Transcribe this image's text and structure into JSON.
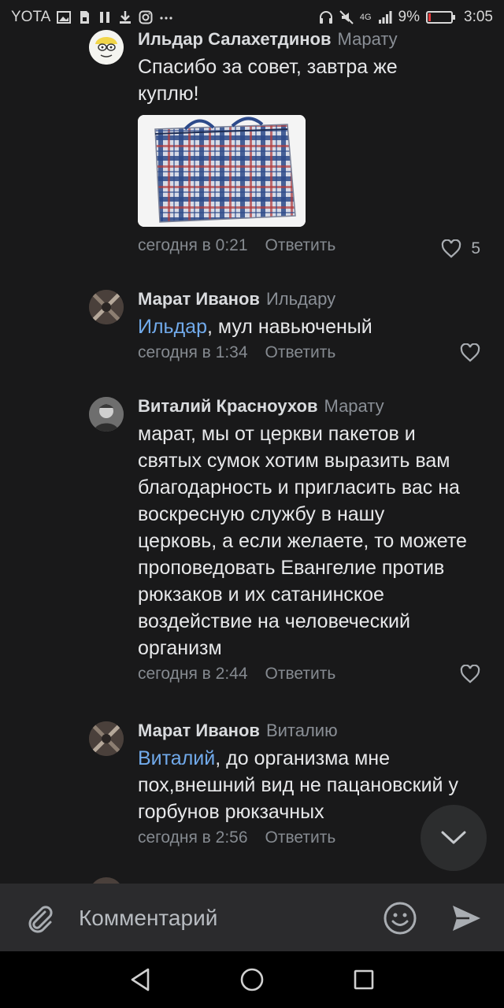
{
  "status_bar": {
    "carrier": "YOTA",
    "network": "4G",
    "battery": "9%",
    "battery_level": 0.09,
    "time": "3:05",
    "icons": [
      "image-icon",
      "sim-icon",
      "pause-icon",
      "download-icon",
      "instagram-icon",
      "more-dots-icon",
      "headphones-icon",
      "mute-icon",
      "signal-icon",
      "battery-icon"
    ]
  },
  "comments": [
    {
      "author": "Ильдар Салахетдинов",
      "reply_to": "Марату",
      "text": "Спасибо за совет, завтра же куплю!",
      "has_image": true,
      "time": "сегодня в 0:21",
      "reply_label": "Ответить",
      "likes": "5"
    },
    {
      "author": "Марат Иванов",
      "reply_to": "Ильдару",
      "mention": "Ильдар",
      "text": ", мул навьюченый",
      "time": "сегодня в 1:34",
      "reply_label": "Ответить"
    },
    {
      "author": "Виталий Красноухов",
      "reply_to": "Марату",
      "text": "марат, мы от церкви пакетов и святых сумок хотим выразить вам благодарность и пригласить вас на воскресную службу в нашу церковь, а если желаете, то можете проповедовать Евангелие против рюкзаков и их сатанинское воздействие на человеческий организм",
      "time": "сегодня в 2:44",
      "reply_label": "Ответить"
    },
    {
      "author": "Марат Иванов",
      "reply_to": "Виталию",
      "mention": "Виталий",
      "text": ", до организма мне пох,внешний вид не пацановский у горбунов рюкзачных",
      "time": "сегодня в 2:56",
      "reply_label": "Ответить"
    }
  ],
  "composer": {
    "placeholder": "Комментарий"
  },
  "colors": {
    "background": "#19191a",
    "mention": "#71aaeb",
    "muted": "#858a90",
    "battery_low": "#e5393a"
  }
}
